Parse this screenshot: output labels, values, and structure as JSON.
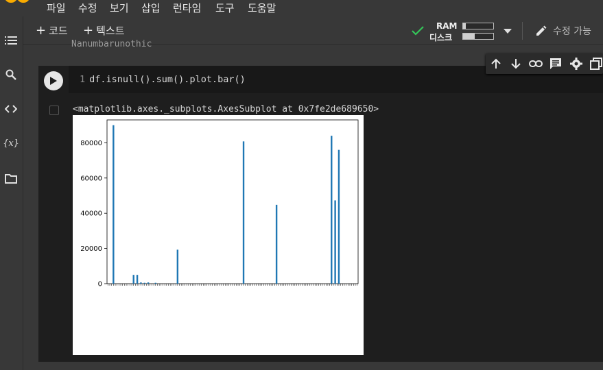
{
  "menu": [
    "파일",
    "수정",
    "보기",
    "삽입",
    "런타임",
    "도구",
    "도움말"
  ],
  "toolbar": {
    "add_code": "코드",
    "add_text": "텍스트",
    "ram_label": "RAM",
    "disk_label": "디스크",
    "edit_label": "수정 가능",
    "ram_usage": 0.08,
    "disk_usage": 0.38
  },
  "sidebar_icons": [
    "table-of-contents-icon",
    "search-icon",
    "code-snippets-icon",
    "variables-icon",
    "files-icon"
  ],
  "variables_glyph": "{x}",
  "cell": {
    "line_number": "1",
    "code": "df.isnull().sum().plot.bar()",
    "previous_output": "Nanumbarunothic",
    "output_text": "<matplotlib.axes._subplots.AxesSubplot at 0x7fe2de689650>"
  },
  "cell_toolbar_icons": [
    "move-up-icon",
    "move-down-icon",
    "link-icon",
    "comment-icon",
    "settings-icon",
    "mirror-cell-icon",
    "delete-icon"
  ],
  "chart_data": {
    "type": "bar",
    "title": "",
    "xlabel": "",
    "ylabel": "",
    "ylim": [
      0,
      93000
    ],
    "yticks": [
      0,
      20000,
      40000,
      60000,
      80000
    ],
    "ytick_labels": [
      "0",
      "20000",
      "40000",
      "60000",
      "80000"
    ],
    "bar_color": "#1f77b4",
    "values": [
      0,
      0,
      0,
      90000,
      0,
      0,
      0,
      0,
      0,
      0,
      0,
      0,
      0,
      0,
      5000,
      0,
      5000,
      0,
      700,
      0,
      500,
      0,
      700,
      0,
      0,
      0,
      500,
      0,
      0,
      0,
      0,
      0,
      0,
      0,
      0,
      0,
      0,
      0,
      19300,
      0,
      0,
      0,
      0,
      0,
      0,
      0,
      0,
      0,
      0,
      0,
      0,
      0,
      0,
      0,
      0,
      0,
      0,
      0,
      0,
      0,
      0,
      0,
      0,
      0,
      0,
      0,
      0,
      0,
      0,
      0,
      0,
      0,
      0,
      0,
      80800,
      0,
      0,
      0,
      0,
      0,
      0,
      0,
      0,
      0,
      0,
      0,
      0,
      0,
      0,
      0,
      0,
      0,
      44800,
      0,
      0,
      0,
      0,
      0,
      0,
      0,
      0,
      0,
      0,
      0,
      0,
      0,
      0,
      0,
      0,
      0,
      0,
      0,
      0,
      0,
      0,
      0,
      0,
      0,
      0,
      0,
      0,
      0,
      84000,
      0,
      47300,
      0,
      76000,
      0,
      0,
      0,
      0,
      0,
      0,
      0,
      0,
      0,
      0
    ]
  }
}
